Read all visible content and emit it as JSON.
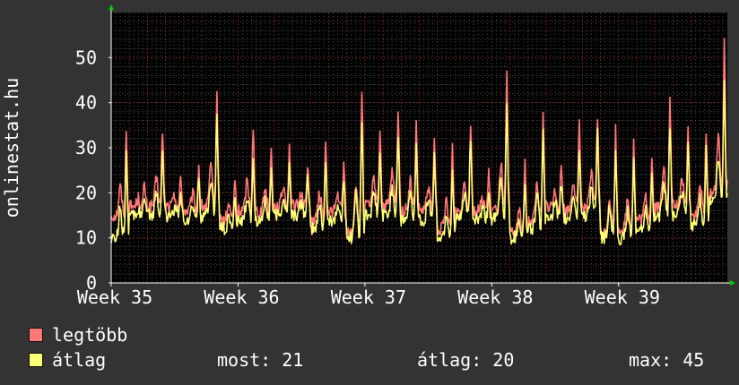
{
  "chart_data": {
    "type": "line",
    "ylabel": "onlinestat.hu",
    "ylim": [
      0,
      60
    ],
    "yticks": [
      0,
      10,
      20,
      30,
      40,
      50
    ],
    "xlim": [
      0,
      34
    ],
    "x_tick_labels": [
      {
        "label": "Week 35",
        "day": 0
      },
      {
        "label": "Week 36",
        "day": 7
      },
      {
        "label": "Week 37",
        "day": 14
      },
      {
        "label": "Week 38",
        "day": 21
      },
      {
        "label": "Week 39",
        "day": 28
      }
    ],
    "grid": true,
    "colors": {
      "background": "#333333",
      "plot": "#000000",
      "grid_minor": "#4a4a4a",
      "grid_major": "#6e2222",
      "axis": "#ffffff",
      "arrow": "#00cc00"
    },
    "series": [
      {
        "name": "legtöbb",
        "color": "#ff7777",
        "daily_peaks": [
          33,
          22,
          34,
          23,
          26,
          41,
          23,
          35,
          30,
          30,
          26,
          31,
          26,
          43,
          34,
          38,
          35,
          31,
          30,
          36,
          24,
          46,
          26,
          37,
          26,
          36,
          37,
          34,
          31,
          28,
          40,
          34,
          34,
          54,
          25
        ],
        "daily_lows": [
          15,
          17,
          17,
          17,
          16,
          17,
          14,
          16,
          16,
          17,
          17,
          14,
          16,
          11,
          17,
          17,
          16,
          16,
          12,
          16,
          16,
          16,
          11,
          14,
          17,
          16,
          17,
          11,
          12,
          14,
          17,
          17,
          15,
          20,
          22
        ]
      },
      {
        "name": "átlag",
        "color": "#ffff77",
        "daily_peaks": [
          28,
          19,
          30,
          19,
          23,
          37,
          19,
          28,
          25,
          26,
          23,
          27,
          22,
          37,
          28,
          33,
          30,
          28,
          25,
          32,
          20,
          40,
          22,
          33,
          22,
          30,
          33,
          30,
          27,
          24,
          35,
          30,
          29,
          44,
          22
        ],
        "daily_lows": [
          10,
          15,
          15,
          15,
          14,
          15,
          12,
          14,
          14,
          15,
          15,
          12,
          14,
          10,
          15,
          15,
          14,
          14,
          10,
          14,
          14,
          14,
          10,
          12,
          15,
          14,
          15,
          10,
          10,
          12,
          15,
          15,
          13,
          18,
          20
        ]
      }
    ]
  },
  "legend": {
    "items": [
      {
        "label": "legtöbb",
        "color": "#ff7777"
      },
      {
        "label": "átlag",
        "color": "#ffff77"
      }
    ],
    "stats": {
      "now": "most: 21",
      "avg": "átlag: 20",
      "max": "max: 45"
    }
  }
}
